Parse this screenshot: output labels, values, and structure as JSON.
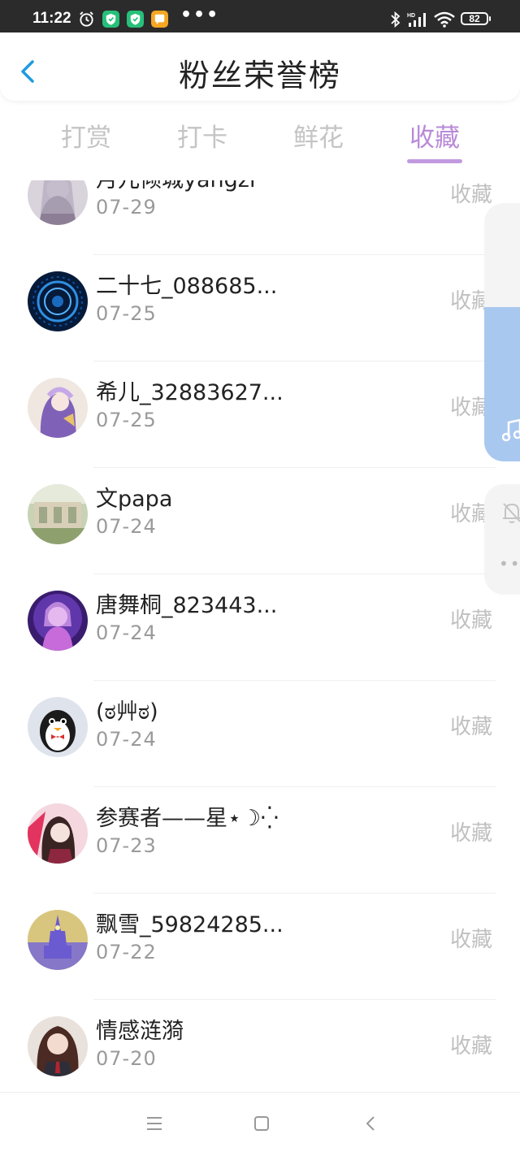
{
  "status_bar": {
    "time": "11:22",
    "battery": "82",
    "more": "•••"
  },
  "header": {
    "title": "粉丝荣誉榜",
    "back_icon": "chevron-left-icon"
  },
  "tabs": [
    {
      "label": "打赏",
      "active": false
    },
    {
      "label": "打卡",
      "active": false
    },
    {
      "label": "鲜花",
      "active": false
    },
    {
      "label": "收藏",
      "active": true
    }
  ],
  "colors": {
    "accent": "#b98ad8",
    "side_fill": "#a9c8f0",
    "back": "#1e9be0"
  },
  "list": [
    {
      "name": "月兀倾城yangzi",
      "date": "07-29",
      "action": "收藏"
    },
    {
      "name": "二十七_088685...",
      "date": "07-25",
      "action": "收藏"
    },
    {
      "name": "希儿_32883627...",
      "date": "07-25",
      "action": "收藏"
    },
    {
      "name": "文papa",
      "date": "07-24",
      "action": "收藏"
    },
    {
      "name": "唐舞桐_823443...",
      "date": "07-24",
      "action": "收藏"
    },
    {
      "name": "(ಠ艸ಠ)",
      "date": "07-24",
      "action": "收藏"
    },
    {
      "name": "参赛者——星⋆☽⁛",
      "date": "07-23",
      "action": "收藏"
    },
    {
      "name": "飘雪_59824285...",
      "date": "07-22",
      "action": "收藏"
    },
    {
      "name": "情感涟漪",
      "date": "07-20",
      "action": "收藏"
    }
  ],
  "side_widget": {
    "music_icon": "music-note-icon",
    "bell_icon": "bell-off-icon",
    "more": "•••"
  },
  "nav": {
    "menu_icon": "menu-icon",
    "home_icon": "home-square-icon",
    "back_icon": "back-triangle-icon"
  }
}
